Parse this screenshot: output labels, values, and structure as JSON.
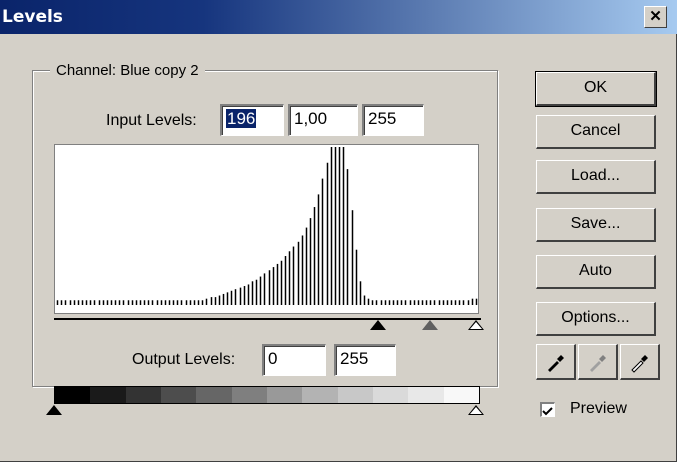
{
  "window": {
    "title": "Levels"
  },
  "channel": {
    "label": "Channel:",
    "value": "Blue copy 2"
  },
  "input_levels": {
    "label": "Input Levels:",
    "black": "196",
    "gamma": "1,00",
    "white": "255"
  },
  "output_levels": {
    "label": "Output Levels:",
    "black": "0",
    "white": "255"
  },
  "buttons": {
    "ok": "OK",
    "cancel": "Cancel",
    "load": "Load...",
    "save": "Save...",
    "auto": "Auto",
    "options": "Options..."
  },
  "preview": {
    "label": "Preview",
    "checked": true
  },
  "histogram_relative_counts": [
    0.03,
    0.03,
    0.03,
    0.03,
    0.03,
    0.03,
    0.03,
    0.03,
    0.03,
    0.03,
    0.03,
    0.03,
    0.03,
    0.03,
    0.03,
    0.03,
    0.03,
    0.03,
    0.03,
    0.03,
    0.03,
    0.03,
    0.03,
    0.03,
    0.03,
    0.03,
    0.03,
    0.03,
    0.03,
    0.03,
    0.03,
    0.03,
    0.03,
    0.03,
    0.03,
    0.03,
    0.04,
    0.05,
    0.05,
    0.06,
    0.07,
    0.08,
    0.09,
    0.1,
    0.11,
    0.12,
    0.13,
    0.15,
    0.16,
    0.18,
    0.2,
    0.22,
    0.24,
    0.26,
    0.28,
    0.31,
    0.34,
    0.37,
    0.4,
    0.44,
    0.49,
    0.55,
    0.62,
    0.7,
    0.8,
    0.9,
    1,
    1,
    1,
    1,
    0.86,
    0.6,
    0.35,
    0.15,
    0.06,
    0.04,
    0.03,
    0.03,
    0.03,
    0.03,
    0.03,
    0.03,
    0.03,
    0.03,
    0.03,
    0.03,
    0.03,
    0.03,
    0.03,
    0.03,
    0.03,
    0.03,
    0.03,
    0.03,
    0.03,
    0.03,
    0.03,
    0.03,
    0.03,
    0.03,
    0.04,
    0.04
  ],
  "slider_values": {
    "input_black": 196,
    "input_gamma": 1.0,
    "input_white": 255,
    "output_black": 0,
    "output_white": 255
  }
}
